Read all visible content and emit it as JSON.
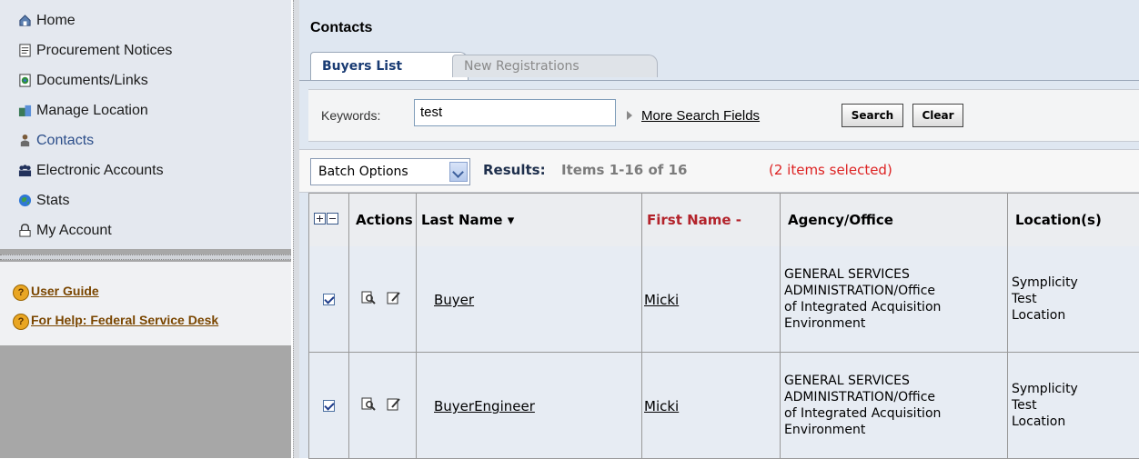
{
  "nav": {
    "items": [
      {
        "label": "Home",
        "icon": "home-icon"
      },
      {
        "label": "Procurement Notices",
        "icon": "notices-icon"
      },
      {
        "label": "Documents/Links",
        "icon": "documents-icon"
      },
      {
        "label": "Manage Location",
        "icon": "location-icon"
      },
      {
        "label": "Contacts",
        "icon": "contacts-icon"
      },
      {
        "label": "Electronic Accounts",
        "icon": "accounts-icon"
      },
      {
        "label": "Stats",
        "icon": "stats-icon"
      },
      {
        "label": "My Account",
        "icon": "account-icon"
      }
    ],
    "help": [
      {
        "label": "User Guide"
      },
      {
        "label": "For Help: Federal Service Desk"
      }
    ]
  },
  "page": {
    "title": "Contacts"
  },
  "tabs": [
    {
      "label": "Buyers List",
      "active": true
    },
    {
      "label": "New Registrations",
      "active": false
    }
  ],
  "search": {
    "label": "Keywords:",
    "value": "test",
    "more": "More Search Fields",
    "search_btn": "Search",
    "clear_btn": "Clear"
  },
  "results": {
    "batch": "Batch Options",
    "label": "Results:",
    "range": "Items 1-16 of 16",
    "selected": "(2 items selected)"
  },
  "table": {
    "headers": {
      "actions": "Actions",
      "last": "Last Name ▾",
      "first": "First Name -",
      "agency": "Agency/Office",
      "location": "Location(s)"
    },
    "rows": [
      {
        "checked": true,
        "last": "Buyer",
        "first": "Micki",
        "agency": [
          "GENERAL SERVICES",
          "ADMINISTRATION/Office",
          "of Integrated Acquisition",
          "Environment"
        ],
        "location": [
          "Symplicity",
          "Test",
          "Location"
        ]
      },
      {
        "checked": true,
        "last": "BuyerEngineer",
        "first": "Micki",
        "agency": [
          "GENERAL SERVICES",
          "ADMINISTRATION/Office",
          "of Integrated Acquisition",
          "Environment"
        ],
        "location": [
          "Symplicity",
          "Test",
          "Location"
        ]
      }
    ]
  },
  "colors": {
    "accent": "#193b73",
    "sort_active": "#b3232b",
    "selected": "#dd2222"
  }
}
